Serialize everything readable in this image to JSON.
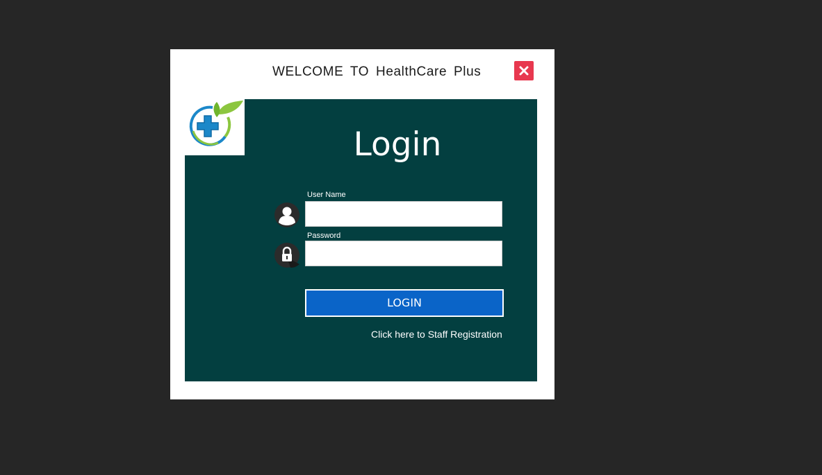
{
  "window": {
    "welcome_text": "WELCOME  TO  HealthCare  Plus",
    "close_icon": "close-x-icon"
  },
  "colors": {
    "desktop_bg": "#262626",
    "window_bg": "#ffffff",
    "panel_bg": "#033f40",
    "close_button": "#e8384f",
    "login_button": "#0a64c8"
  },
  "login": {
    "title": "Login",
    "username": {
      "label": "User Name",
      "value": "",
      "icon": "user-avatar-icon"
    },
    "password": {
      "label": "Password",
      "value": "",
      "icon": "lock-icon"
    },
    "submit_label": "LOGIN",
    "register_link": "Click here to Staff Registration"
  },
  "logo": {
    "icon": "medical-cross-leaf-logo"
  }
}
